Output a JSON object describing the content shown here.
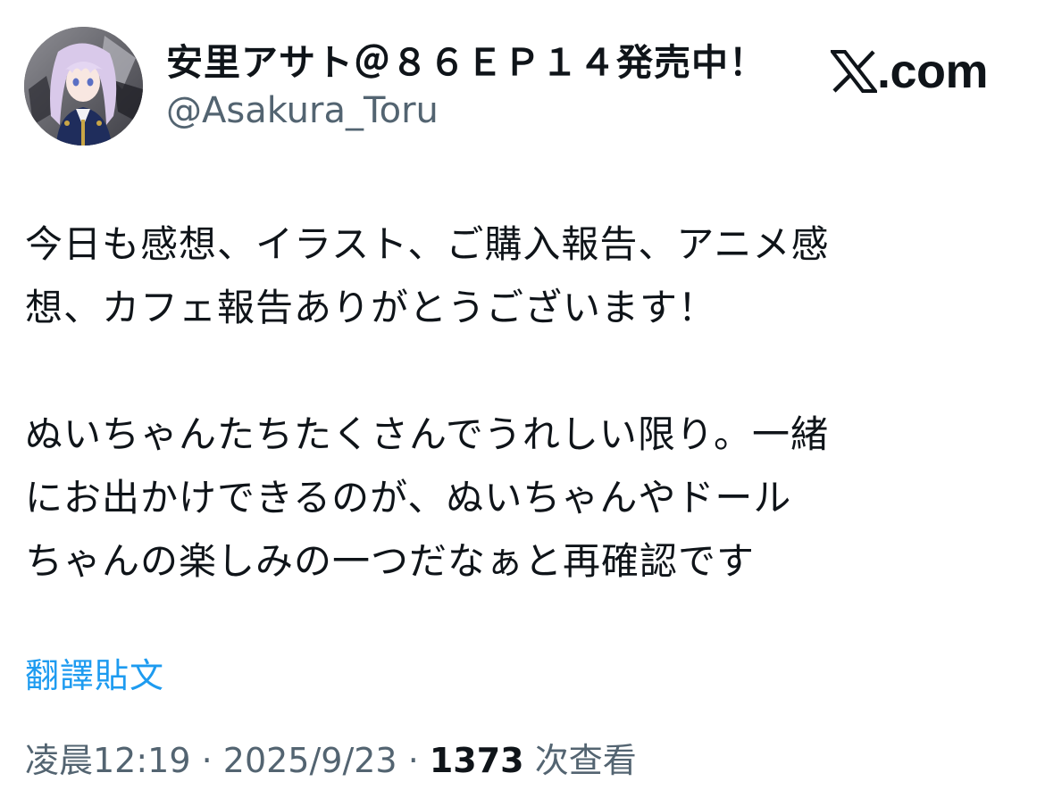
{
  "header": {
    "display_name": "安里アサト＠８６ＥＰ１４発売中！",
    "handle": "@Asakura_Toru",
    "brand": ".com",
    "avatar_icon": "anime-character-avatar"
  },
  "tweet": {
    "paragraphs": [
      [
        "今日も感想、イラスト、ご購入報告、アニメ感",
        "想、カフェ報告ありがとうございます！"
      ],
      [
        "ぬいちゃんたちたくさんでうれしい限り。一緒",
        "にお出かけできるのが、ぬいちゃんやドール",
        "ちゃんの楽しみの一つだなぁと再確認です"
      ]
    ]
  },
  "translate_label": "翻譯貼文",
  "meta": {
    "time": "凌晨12:19",
    "separator": " · ",
    "date": "2025/9/23",
    "views_count": "1373",
    "views_label": " 次查看"
  },
  "colors": {
    "text": "#0f1419",
    "secondary": "#536471",
    "link": "#1d9bf0"
  }
}
